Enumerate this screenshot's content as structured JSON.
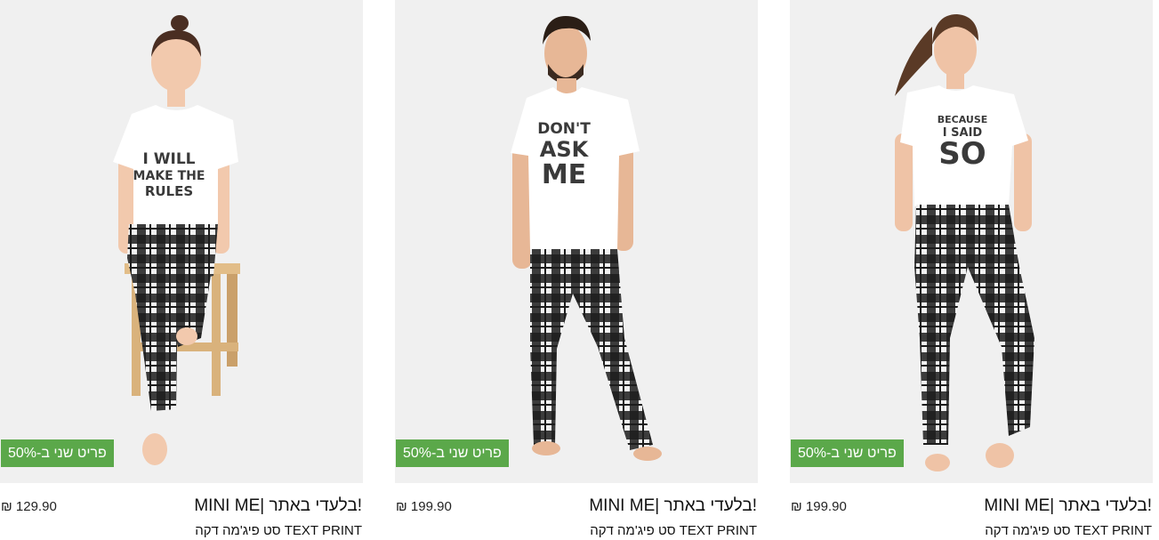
{
  "products": [
    {
      "badge": "פריט שני ב-50%",
      "price": "₪ 129.90",
      "title": "MINI ME| בלעדי באתר!",
      "subtitle": "סט פיג'מה דקה TEXT PRINT",
      "shirt_text": [
        "I WILL",
        "MAKE THE",
        "RULES"
      ]
    },
    {
      "badge": "פריט שני ב-50%",
      "price": "₪ 199.90",
      "title": "MINI ME| בלעדי באתר!",
      "subtitle": "סט פיג'מה דקה TEXT PRINT",
      "shirt_text": [
        "DON'T",
        "ASK",
        "ME"
      ]
    },
    {
      "badge": "פריט שני ב-50%",
      "price": "₪ 199.90",
      "title": "MINI ME| בלעדי באתר!",
      "subtitle": "סט פיג'מה דקה TEXT PRINT",
      "shirt_text": [
        "BECAUSE",
        "I SAID",
        "SO"
      ]
    }
  ],
  "colors": {
    "badge_bg": "#5ba84a",
    "photo_bg": "#f0f0f0",
    "shirt": "#ffffff",
    "shirt_print": "#3a3a3a",
    "plaid_dark": "#1c1c1c",
    "plaid_light": "#f2f2f2"
  }
}
